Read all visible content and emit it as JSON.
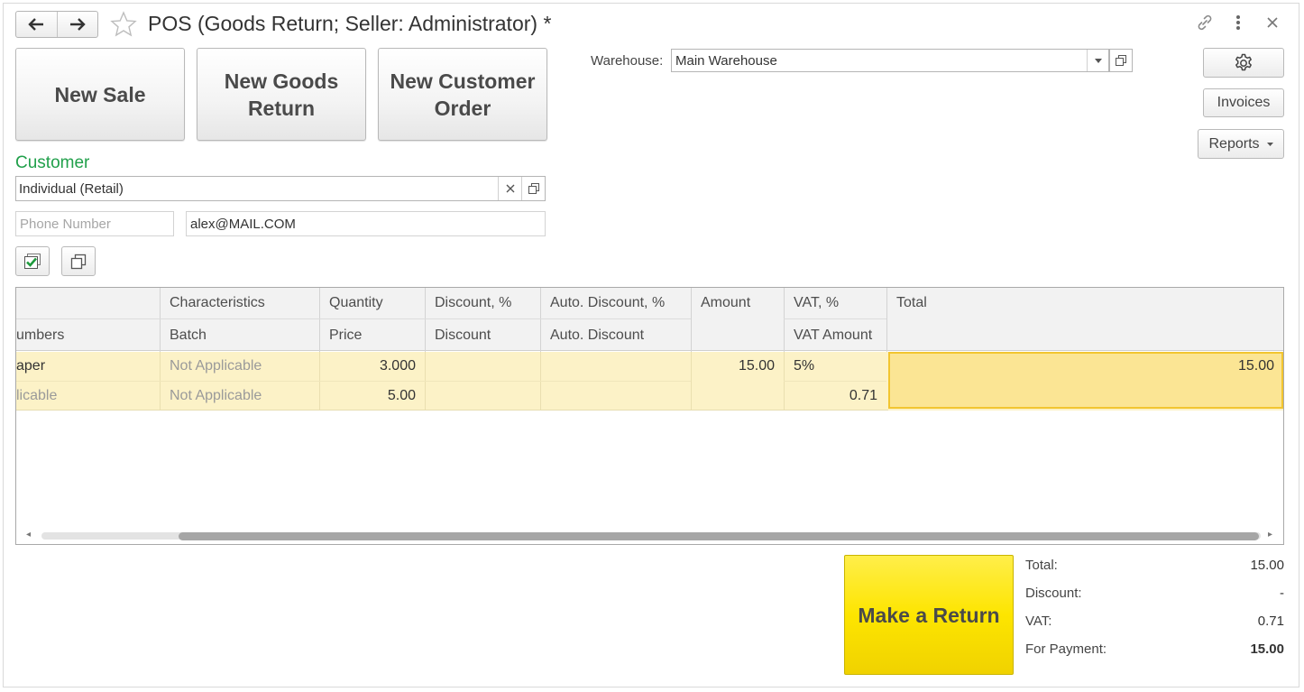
{
  "window": {
    "title": "POS (Goods Return; Seller: Administrator) *"
  },
  "actions": {
    "new_sale": "New Sale",
    "new_goods_return": "New Goods Return",
    "new_customer_order": "New Customer Order"
  },
  "warehouse": {
    "label": "Warehouse:",
    "value": "Main Warehouse"
  },
  "side_buttons": {
    "invoices": "Invoices",
    "reports": "Reports"
  },
  "customer": {
    "title": "Customer",
    "value": "Individual (Retail)",
    "phone_placeholder": "Phone Number",
    "phone_value": "",
    "email_value": "alex@MAIL.COM"
  },
  "table": {
    "headers_row1": {
      "col0": "",
      "characteristics": "Characteristics",
      "quantity": "Quantity",
      "discount_pct": "Discount, %",
      "auto_discount_pct": "Auto. Discount, %",
      "amount": "Amount",
      "vat_pct": "VAT, %",
      "total": "Total"
    },
    "headers_row2": {
      "col0": "umbers",
      "batch": "Batch",
      "price": "Price",
      "discount": "Discount",
      "auto_discount": "Auto. Discount",
      "vat_amount": "VAT Amount"
    },
    "rows": [
      {
        "line1": {
          "col0": "aper",
          "characteristics": "Not Applicable",
          "quantity": "3.000",
          "discount_pct": "",
          "auto_discount_pct": "",
          "amount": "15.00",
          "vat_pct": "5%",
          "total": "15.00"
        },
        "line2": {
          "col0": "licable",
          "batch": "Not Applicable",
          "price": "5.00",
          "discount": "",
          "auto_discount": "",
          "vat_amount": "0.71"
        }
      }
    ]
  },
  "return_button": "Make a Return",
  "summary": {
    "total_label": "Total:",
    "total_value": "15.00",
    "discount_label": "Discount:",
    "discount_value": "-",
    "vat_label": "VAT:",
    "vat_value": "0.71",
    "payment_label": "For Payment:",
    "payment_value": "15.00"
  },
  "icons": {
    "back": "arrow-left-icon",
    "forward": "arrow-right-icon",
    "favorite": "star-icon",
    "link": "link-icon",
    "more": "more-vertical-icon",
    "close": "close-icon",
    "settings": "gear-icon",
    "dropdown": "chevron-down-icon",
    "open": "open-window-icon",
    "clear": "clear-icon",
    "select_all": "checkbox-icon",
    "copy": "copy-icon"
  },
  "colors": {
    "accent_green": "#21a04b",
    "row_highlight": "#fcf2c7",
    "selected_cell": "#fbe594",
    "return_button": "#fde500"
  }
}
